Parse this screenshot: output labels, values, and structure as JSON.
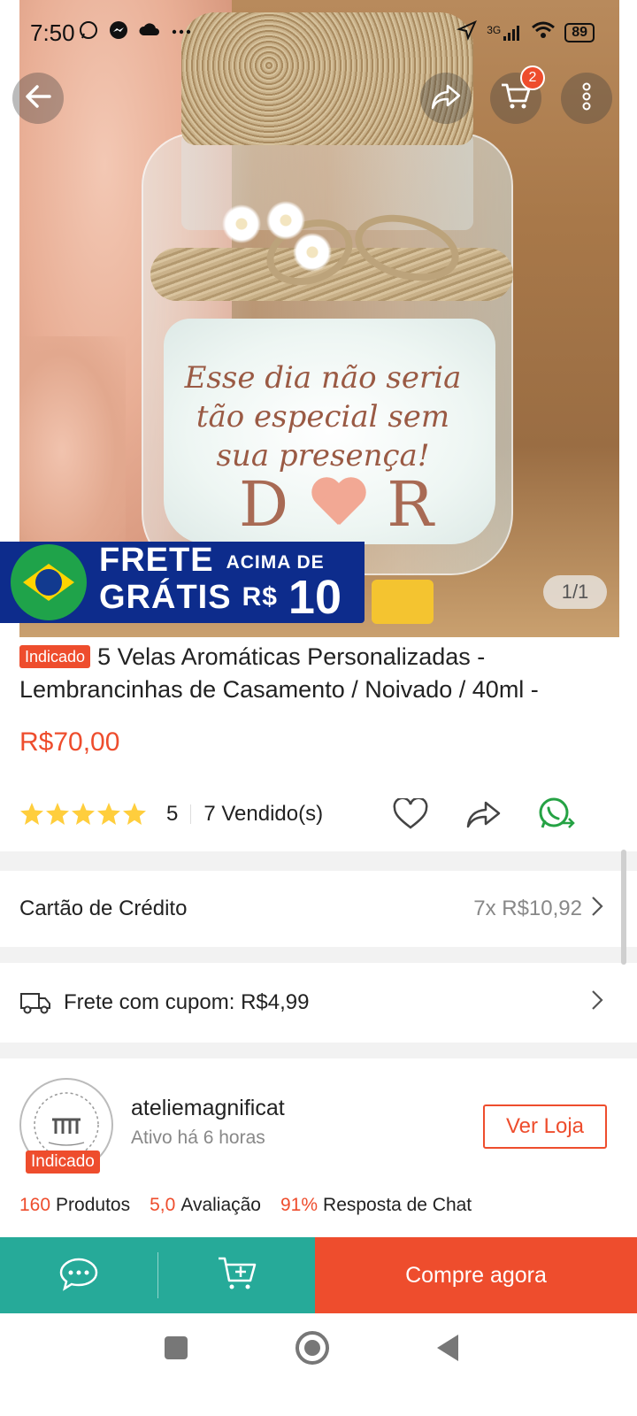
{
  "status_bar": {
    "time": "7:50",
    "network": "3G",
    "battery": "89",
    "left_icons": [
      "whatsapp-icon",
      "messenger-icon",
      "cloud-icon",
      "more-dots-icon"
    ],
    "right_icons": [
      "navigation-icon",
      "signal-icon",
      "wifi-icon",
      "battery-icon"
    ]
  },
  "header": {
    "cart_count": "2",
    "icons": [
      "back-arrow-icon",
      "share-icon",
      "cart-icon",
      "more-vertical-icon"
    ]
  },
  "hero": {
    "jar_text_lines": [
      "Esse dia não seria",
      "tão especial sem",
      "sua presença!"
    ],
    "initial_left": "D",
    "initial_right": "R",
    "image_counter": "1/1"
  },
  "promo_banner": {
    "line1": "FRETE",
    "line2": "GRÁTIS",
    "above_label": "ACIMA DE",
    "currency": "R$",
    "amount": "10"
  },
  "product": {
    "badge": "Indicado",
    "title": "5 Velas Aromáticas Personalizadas - Lembrancinhas de Casamento / Noivado / 40ml -",
    "price": "R$70,00",
    "rating": "5",
    "stars": 5,
    "sold": "7 Vendido(s)"
  },
  "payment": {
    "label": "Cartão de Crédito",
    "installments": "7x R$10,92"
  },
  "shipping": {
    "label": "Frete com cupom: R$4,99"
  },
  "shop": {
    "name": "ateliemagnificat",
    "active": "Ativo há 6 horas",
    "badge": "Indicado",
    "visit_button": "Ver Loja",
    "stats": [
      {
        "value": "160",
        "label": "Produtos"
      },
      {
        "value": "5,0",
        "label": "Avaliação"
      },
      {
        "value": "91%",
        "label": "Resposta de Chat"
      }
    ]
  },
  "bottom_bar": {
    "buy_now": "Compre agora"
  },
  "colors": {
    "brand": "#ee4d2d",
    "teal": "#26aa99",
    "banner_blue": "#0d2c8c",
    "star": "#ffce3d"
  }
}
